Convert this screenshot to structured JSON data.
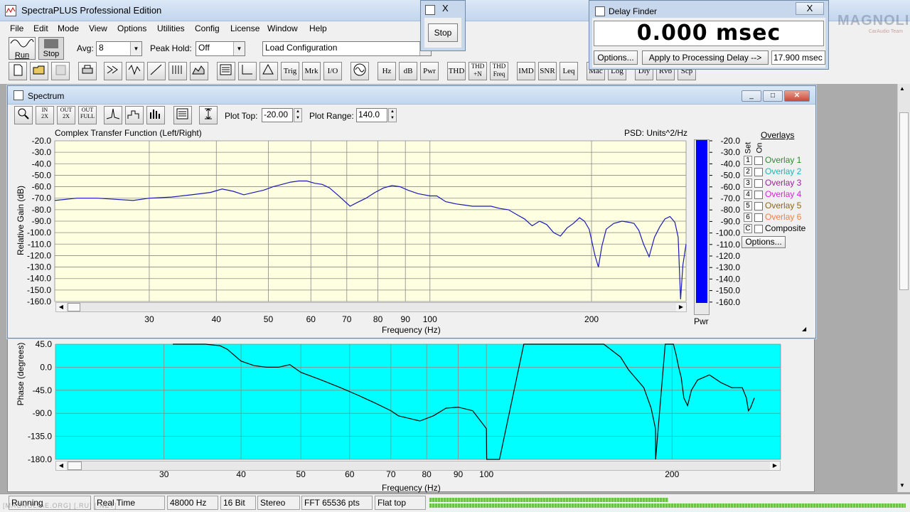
{
  "app": {
    "title": "SpectraPLUS Professional Edition",
    "menu": [
      "File",
      "Edit",
      "Mode",
      "View",
      "Options",
      "Utilities",
      "Config",
      "License",
      "Window",
      "Help"
    ],
    "run_label": "Run",
    "stop_label": "Stop",
    "avg_label": "Avg:",
    "avg_value": "8",
    "peak_hold_label": "Peak Hold:",
    "peak_hold_value": "Off",
    "config_value": "Load Configuration",
    "toolbar_text_buttons": [
      "Trig",
      "Mrk",
      "I/O",
      "Hz",
      "dB",
      "Pwr",
      "THD",
      "THD +N",
      "THD Freq",
      "IMD",
      "SNR",
      "Leq",
      "Mac",
      "Log",
      "Dly",
      "Rvb",
      "Scp"
    ]
  },
  "stop_dialog": {
    "close": "X",
    "stop_label": "Stop"
  },
  "delay_finder": {
    "title": "Delay Finder",
    "close": "X",
    "value": "0.000 msec",
    "options_label": "Options...",
    "apply_label": "Apply to Processing Delay -->",
    "delay_field": "17.900 msec"
  },
  "watermark": {
    "logo_text": "MAGNOLIA",
    "logo_sub": "CarAudio Team",
    "url_text": "[MAGNOLIAE.ORG] [.RU] [.NET]"
  },
  "spectrum": {
    "title": "Spectrum",
    "plot_top_label": "Plot Top:",
    "plot_top_value": "-20.00",
    "plot_range_label": "Plot Range:",
    "plot_range_value": "140.0",
    "chart_title": "Complex Transfer Function (Left/Right)",
    "psd_label": "PSD: Units^2/Hz",
    "pwr_label": "Pwr",
    "overlays_header": "Overlays",
    "set_label": "Set",
    "on_label": "On",
    "overlays": [
      {
        "num": "1",
        "name": "Overlay 1",
        "color": "#2e8b2e"
      },
      {
        "num": "2",
        "name": "Overlay 2",
        "color": "#1fb5b5"
      },
      {
        "num": "3",
        "name": "Overlay 3",
        "color": "#a020a0"
      },
      {
        "num": "4",
        "name": "Overlay 4",
        "color": "#e020e0"
      },
      {
        "num": "5",
        "name": "Overlay 5",
        "color": "#8b6914"
      },
      {
        "num": "6",
        "name": "Overlay 6",
        "color": "#f08040"
      },
      {
        "num": "C",
        "name": "Composite",
        "color": "#000000"
      }
    ],
    "options_btn": "Options..."
  },
  "chart_data": [
    {
      "type": "line",
      "title": "Complex Transfer Function (Left/Right)",
      "xlabel": "Frequency (Hz)",
      "ylabel": "Relative Gain (dB)",
      "x_scale": "log",
      "xlim": [
        20,
        300
      ],
      "ylim": [
        -160,
        -20
      ],
      "yticks": [
        "-20.0",
        "-30.0",
        "-40.0",
        "-50.0",
        "-60.0",
        "-70.0",
        "-80.0",
        "-90.0",
        "-100.0",
        "-110.0",
        "-120.0",
        "-130.0",
        "-140.0",
        "-150.0",
        "-160.0"
      ],
      "xticks": [
        "30",
        "40",
        "50",
        "60",
        "70",
        "80",
        "90",
        "100",
        "200"
      ],
      "grid": true,
      "series": [
        {
          "color": "#1a1ab8",
          "x": [
            20,
            22,
            24,
            26,
            28,
            30,
            33,
            36,
            39,
            41,
            43,
            45,
            47,
            49,
            51,
            53,
            55,
            57,
            59,
            61,
            63,
            65,
            68,
            71,
            73,
            76,
            79,
            82,
            85,
            88,
            91,
            95,
            100,
            103,
            107,
            112,
            116,
            120,
            125,
            130,
            135,
            140,
            146,
            150,
            155,
            160,
            165,
            170,
            175,
            180,
            185,
            190,
            194,
            198,
            203,
            206,
            209,
            213,
            220,
            228,
            235,
            240,
            245,
            250,
            256,
            262,
            268,
            274,
            280,
            286,
            290,
            293,
            296,
            300
          ],
          "y": [
            -72,
            -70,
            -70,
            -71,
            -72,
            -70,
            -69,
            -67,
            -65,
            -62,
            -64,
            -67,
            -65,
            -63,
            -60,
            -58,
            -56,
            -55,
            -55,
            -57,
            -58,
            -61,
            -69,
            -77,
            -74,
            -70,
            -65,
            -61,
            -59,
            -60,
            -63,
            -66,
            -68,
            -68,
            -73,
            -75,
            -76,
            -77,
            -77,
            -77,
            -79,
            -80,
            -85,
            -88,
            -94,
            -90,
            -93,
            -100,
            -103,
            -96,
            -92,
            -87,
            -90,
            -97,
            -120,
            -130,
            -112,
            -97,
            -92,
            -90,
            -91,
            -92,
            -98,
            -110,
            -121,
            -104,
            -95,
            -88,
            -86,
            -91,
            -104,
            -158,
            -128,
            -110
          ]
        }
      ]
    },
    {
      "type": "line",
      "xlabel": "Frequency (Hz)",
      "ylabel": "Phase (degrees)",
      "x_scale": "log",
      "xlim": [
        20,
        300
      ],
      "ylim": [
        -180,
        45
      ],
      "yticks": [
        "45.0",
        "0.0",
        "-45.0",
        "-90.0",
        "-135.0",
        "-180.0"
      ],
      "xticks": [
        "30",
        "40",
        "50",
        "60",
        "70",
        "80",
        "90",
        "100",
        "200"
      ],
      "grid": true,
      "series": [
        {
          "color": "#000000",
          "x": [
            31,
            33,
            35,
            37,
            38,
            40,
            42,
            44,
            46,
            48,
            50,
            54,
            58,
            62,
            66,
            70,
            72,
            75,
            78,
            82,
            86,
            90,
            95,
            100,
            100.1,
            105,
            115,
            125,
            140,
            155,
            165,
            170,
            180,
            185,
            188,
            188.1,
            195,
            198,
            201,
            203,
            205,
            207,
            209,
            212,
            215,
            220,
            230,
            240,
            250,
            260,
            264,
            266,
            268,
            272
          ],
          "y": [
            45,
            45,
            45,
            42,
            35,
            12,
            3,
            0,
            0,
            5,
            -10,
            -25,
            -40,
            -55,
            -70,
            -85,
            -95,
            -100,
            -105,
            -95,
            -80,
            -78,
            -85,
            -120,
            -180,
            -180,
            45,
            45,
            45,
            45,
            20,
            -5,
            -40,
            -80,
            -120,
            -180,
            45,
            45,
            45,
            25,
            0,
            -20,
            -60,
            -75,
            -45,
            -25,
            -15,
            -30,
            -40,
            -40,
            -60,
            -85,
            -80,
            -60
          ]
        }
      ]
    }
  ],
  "phase_panel": {
    "xlabel": "Frequency (Hz)",
    "ylabel": "Phase (degrees)"
  },
  "status": [
    "Running",
    "Real Time",
    "48000 Hz",
    "16 Bit",
    "Stereo",
    "FFT 65536 pts",
    "Flat top"
  ]
}
